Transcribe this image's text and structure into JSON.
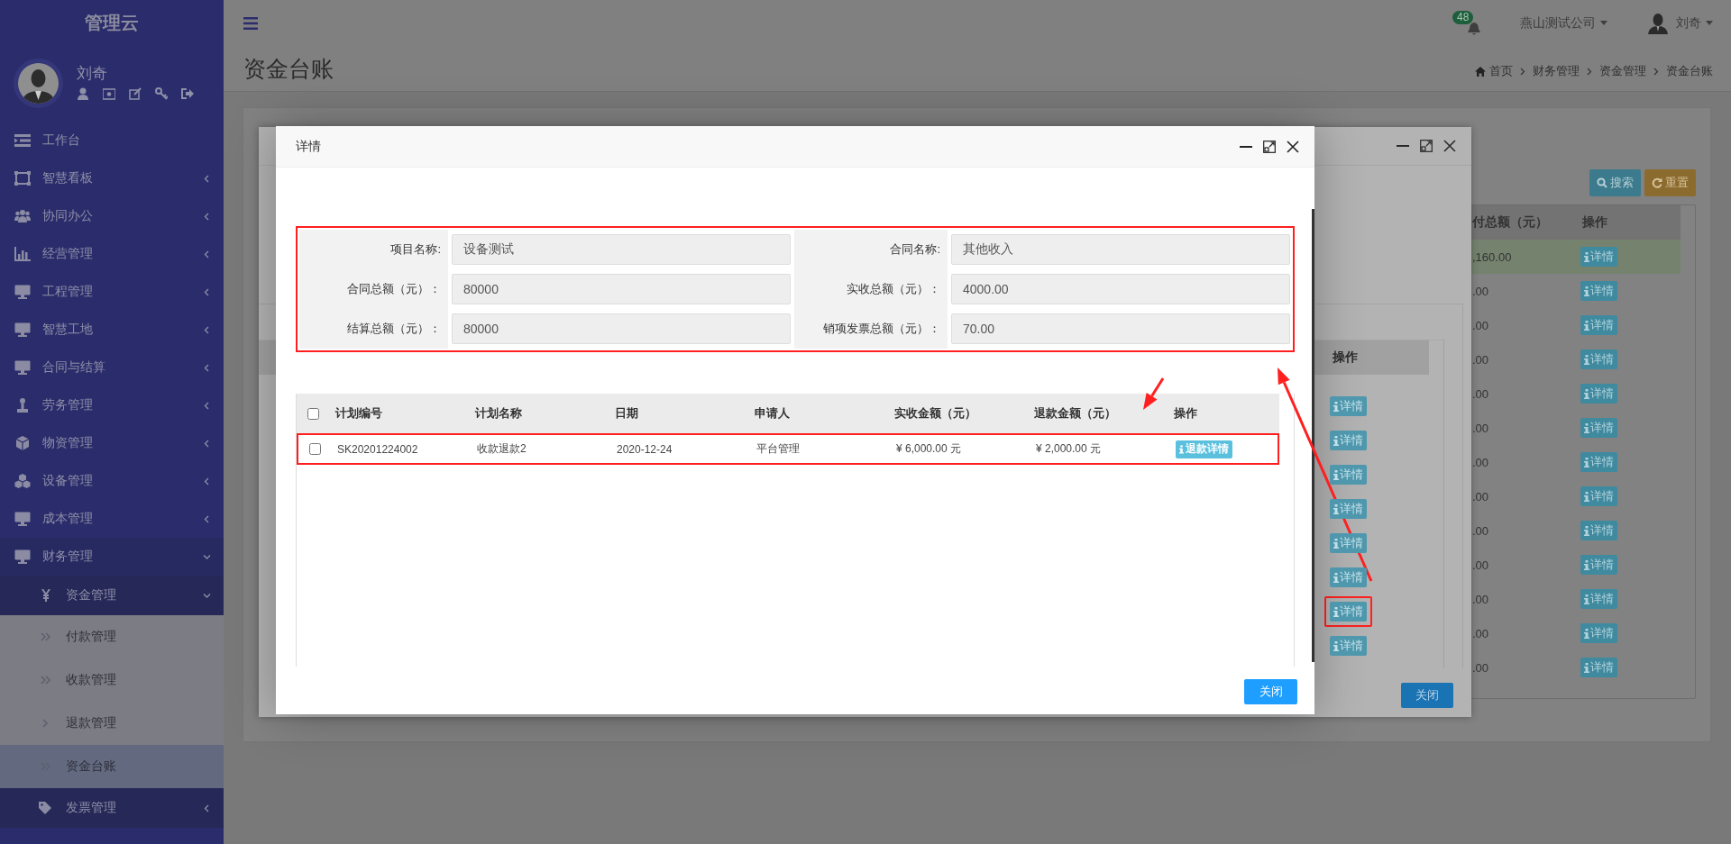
{
  "sidebar": {
    "title": "管理云",
    "user": {
      "name": "刘奇"
    },
    "items": [
      {
        "label": "工作台"
      },
      {
        "label": "智慧看板",
        "expanded": false
      },
      {
        "label": "协同办公",
        "expanded": false
      },
      {
        "label": "经营管理",
        "expanded": false
      },
      {
        "label": "工程管理",
        "expanded": false
      },
      {
        "label": "智慧工地",
        "expanded": false
      },
      {
        "label": "合同与结算",
        "expanded": false
      },
      {
        "label": "劳务管理",
        "expanded": false
      },
      {
        "label": "物资管理",
        "expanded": false
      },
      {
        "label": "设备管理",
        "expanded": false
      },
      {
        "label": "成本管理",
        "expanded": false
      },
      {
        "label": "财务管理",
        "expanded": true,
        "children": [
          {
            "label": "资金管理",
            "expanded": true,
            "children": [
              {
                "label": "付款管理",
                "selected": false
              },
              {
                "label": "收款管理",
                "selected": false
              },
              {
                "label": "退款管理",
                "selected": false
              },
              {
                "label": "资金台账",
                "selected": true
              }
            ]
          },
          {
            "label": "发票管理",
            "expanded": false
          }
        ]
      }
    ]
  },
  "topbar": {
    "notification_count": "48",
    "company": "燕山测试公司",
    "user_name": "刘奇"
  },
  "page": {
    "title": "资金台账",
    "breadcrumb": [
      "首页",
      "财务管理",
      "资金管理",
      "资金台账"
    ]
  },
  "background_page": {
    "buttons": [
      {
        "kind": "search",
        "label": "搜索"
      },
      {
        "kind": "reset",
        "label": "重置"
      }
    ],
    "table": {
      "columns": [
        "付总额（元）",
        "操作"
      ],
      "rows": [
        {
          "column_1": ",160.00",
          "action": "详情",
          "selected": true
        },
        {
          "column_1": ".00",
          "action": "详情",
          "selected": false
        },
        {
          "column_1": ".00",
          "action": "详情",
          "selected": false
        },
        {
          "column_1": ".00",
          "action": "详情",
          "selected": false
        },
        {
          "column_1": ".00",
          "action": "详情",
          "selected": false
        },
        {
          "column_1": ".00",
          "action": "详情",
          "selected": false
        },
        {
          "column_1": ".00",
          "action": "详情",
          "selected": false
        },
        {
          "column_1": ".00",
          "action": "详情",
          "selected": false
        },
        {
          "column_1": ".00",
          "action": "详情",
          "selected": false
        },
        {
          "column_1": ".00",
          "action": "详情",
          "selected": false
        },
        {
          "column_1": ".00",
          "action": "详情",
          "selected": false
        },
        {
          "column_1": ".00",
          "action": "详情",
          "selected": false
        },
        {
          "column_1": ".00",
          "action": "详情",
          "selected": false
        }
      ]
    }
  },
  "background_dialog": {
    "table": {
      "columns": [
        "操作"
      ],
      "rows": [
        {
          "action": "详情",
          "highlighted": false
        },
        {
          "action": "详情",
          "highlighted": false
        },
        {
          "action": "详情",
          "highlighted": false
        },
        {
          "action": "详情",
          "highlighted": false
        },
        {
          "action": "详情",
          "highlighted": false
        },
        {
          "action": "详情",
          "highlighted": false
        },
        {
          "action": "详情",
          "highlighted": true
        },
        {
          "action": "详情",
          "highlighted": false
        }
      ]
    },
    "close_button": "关闭"
  },
  "detail_dialog": {
    "title": "详情",
    "summary": {
      "highlighted": true,
      "fields": [
        {
          "label": "项目名称:",
          "value": "设备测试"
        },
        {
          "label": "合同名称:",
          "value": "其他收入"
        },
        {
          "label": "合同总额（元）：",
          "value": "80000"
        },
        {
          "label": "实收总额（元）：",
          "value": "4000.00"
        },
        {
          "label": "结算总额（元）：",
          "value": "80000"
        },
        {
          "label": "销项发票总额（元）：",
          "value": "70.00"
        }
      ]
    },
    "table": {
      "header_checked": false,
      "columns": [
        "计划编号",
        "计划名称",
        "日期",
        "申请人",
        "实收金额（元）",
        "退款金额（元）",
        "操作"
      ],
      "rows": [
        {
          "checked": false,
          "cells": [
            "SK20201224002",
            "收款退款2",
            "2020-12-24",
            "平台管理",
            "¥ 6,000.00 元",
            "¥ 2,000.00 元"
          ],
          "action": "退款详情",
          "highlighted": true
        }
      ]
    },
    "close_button": "关闭"
  },
  "annotations": [
    {
      "kind": "arrow"
    },
    {
      "kind": "arrow"
    }
  ]
}
